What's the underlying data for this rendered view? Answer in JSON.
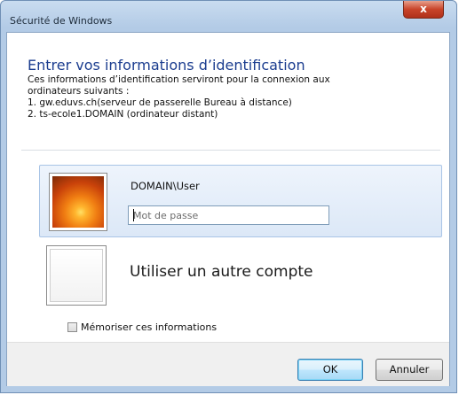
{
  "window": {
    "title": "Sécurité de Windows",
    "close_glyph": "x"
  },
  "dialog": {
    "main_instruction": "Entrer vos informations d’identification",
    "description_lines": [
      "Ces informations d’identification serviront pour la connexion aux",
      "ordinateurs suivants :",
      "1. gw.eduvs.ch(serveur de passerelle Bureau à distance)",
      "2. ts-ecole1.DOMAIN (ordinateur distant)"
    ]
  },
  "credential_tile": {
    "username": "DOMAIN\\User",
    "password_value": "",
    "password_placeholder": "Mot de passe",
    "avatar_icon": "flower-avatar-icon"
  },
  "other_account": {
    "label": "Utiliser un autre compte",
    "avatar_icon": "blank-avatar-icon"
  },
  "remember": {
    "label": "Mémoriser ces informations",
    "checked": false
  },
  "buttons": {
    "ok": "OK",
    "cancel": "Annuler"
  },
  "colors": {
    "accent": "#1b3d8f",
    "selection": "#dce8f7",
    "close_button": "#c8442a"
  }
}
